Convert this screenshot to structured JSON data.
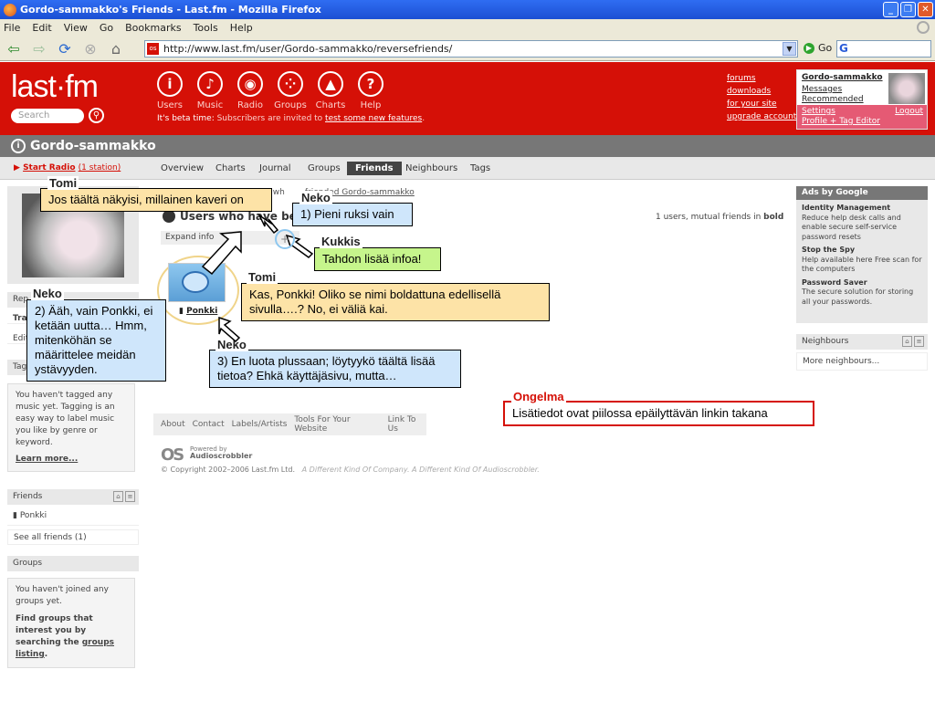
{
  "browser": {
    "title": "Gordo-sammakko's Friends - Last.fm - Mozilla Firefox",
    "menu": [
      "File",
      "Edit",
      "View",
      "Go",
      "Bookmarks",
      "Tools",
      "Help"
    ],
    "url": "http://www.last.fm/user/Gordo-sammakko/reversefriends/",
    "go_label": "Go",
    "search_engine": "G"
  },
  "header": {
    "logo": "last·fm",
    "search_placeholder": "Search",
    "nav": [
      "Users",
      "Music",
      "Radio",
      "Groups",
      "Charts",
      "Help"
    ],
    "beta_label": "It's beta time:",
    "beta_text": " Subscribers are invited to ",
    "beta_link": "test some new features",
    "beta_end": ".",
    "links": [
      "forums",
      "downloads",
      "for your site",
      "upgrade account"
    ],
    "user": {
      "name": "Gordo-sammakko",
      "messages": "Messages",
      "recommended": "Recommended",
      "settings": "Settings",
      "logout": "Logout",
      "profile_editor": "Profile + Tag Editor"
    }
  },
  "profile": {
    "name": "Gordo-sammakko",
    "start_radio": "Start Radio",
    "station_count": "(1 station)",
    "tabs": [
      "Overview",
      "Charts",
      "Journal",
      "Groups",
      "Friends",
      "Neighbours",
      "Tags"
    ],
    "active_tab": "Friends"
  },
  "left": {
    "rep_label": "Rep",
    "tra_label": "Tra",
    "edit_label": "Edit",
    "tags_header": "Tags",
    "tags_text": "You haven't tagged any music yet. Tagging is an easy way to label music you like by genre or keyword.",
    "learn_more": "Learn more...",
    "friends_header": "Friends",
    "friend_item": "Ponkki",
    "see_all": "See all friends (1)",
    "groups_header": "Groups",
    "groups_text": "You haven't joined any groups yet.",
    "groups_find": "Find groups that interest you by searching the ",
    "groups_link": "groups listing",
    "groups_end": "."
  },
  "main": {
    "crumb_pre": "ers wh",
    "crumb_link": "friended Gordo-sammakko",
    "section_title": "Users who have befri",
    "mutual_text": "1 users, mutual friends in ",
    "mutual_bold": "bold",
    "expand_info": "Expand info",
    "friend_name": "Ponkki",
    "footer_links": [
      "About",
      "Contact",
      "Labels/Artists",
      "Tools For Your Website",
      "Link To Us"
    ],
    "as_logo": "OS",
    "powered_by": "Powered by",
    "audioscrobbler": "Audioscrobbler",
    "copyright": "© Copyright 2002–2006 Last.fm Ltd.",
    "tagline": "A Different Kind Of Company. A Different Kind Of Audioscrobbler."
  },
  "right": {
    "ads_header": "Ads by Google",
    "ads": [
      {
        "title": "Identity Management",
        "text": "Reduce help desk calls and enable secure self-service password resets"
      },
      {
        "title": "Stop the Spy",
        "text": "Help available here Free scan for the computers"
      },
      {
        "title": "Password Saver",
        "text": "The secure solution for storing all your passwords."
      }
    ],
    "neighbours_header": "Neighbours",
    "more_neighbours": "More neighbours..."
  },
  "notes": {
    "tomi1": {
      "tag": "Tomi",
      "text": "Jos täältä näkyisi, millainen kaveri on"
    },
    "neko1": {
      "tag": "Neko",
      "text": "1) Pieni ruksi vain"
    },
    "kukkis": {
      "tag": "Kukkis",
      "text": "Tahdon lisää infoa!"
    },
    "tomi2": {
      "tag": "Tomi",
      "text": "Kas, Ponkki! Oliko se nimi boldattuna edellisellä sivulla….? No, ei väliä kai."
    },
    "neko2": {
      "tag": "Neko",
      "text": "2) Ääh, vain Ponkki, ei ketään uutta… Hmm, mitenköhän se määrittelee meidän ystävyyden."
    },
    "neko3": {
      "tag": "Neko",
      "text": "3) En luota plussaan; löytyykö täältä lisää tietoa? Ehkä käyttäjäsivu, mutta…"
    },
    "ongelma": {
      "tag": "Ongelma",
      "text": "Lisätiedot ovat piilossa epäilyttävän linkin takana"
    }
  }
}
